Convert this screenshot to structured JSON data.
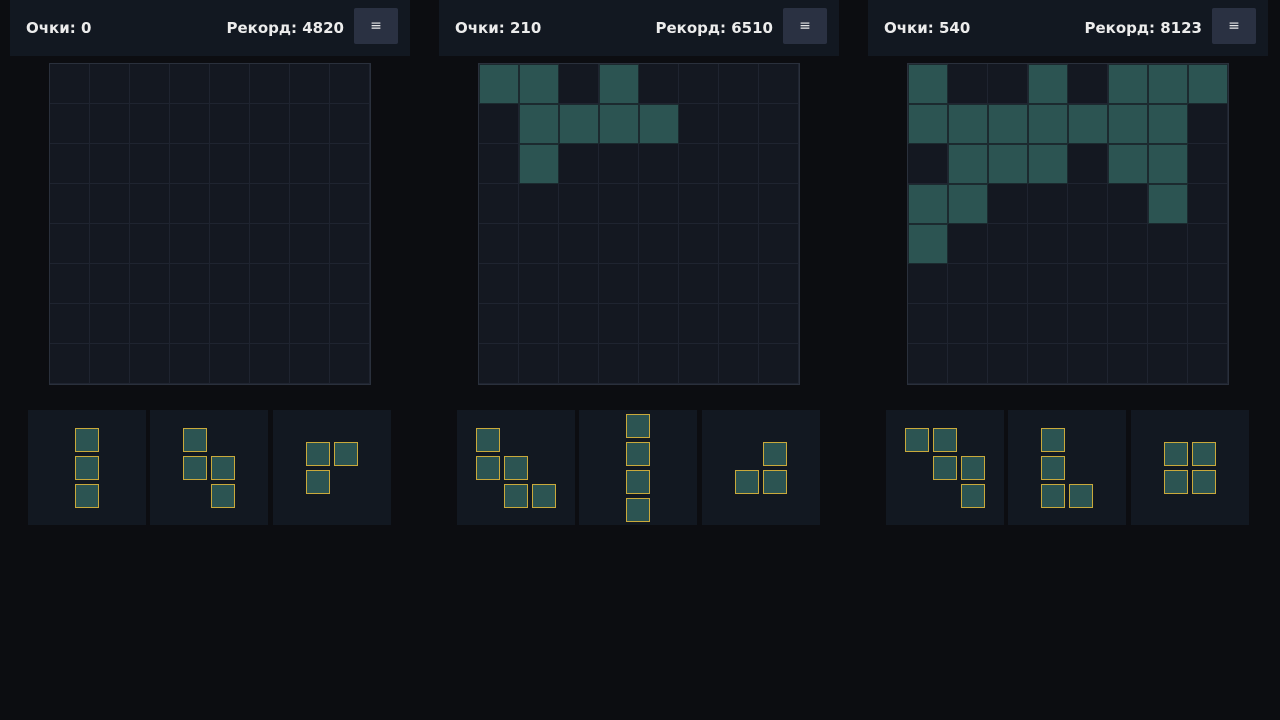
{
  "menu_icon": "≡",
  "colors": {
    "background": "#0c0d11",
    "header": "#121821",
    "board": "#141821",
    "filled_cell": "#2c5452",
    "piece_border": "#c9a93b"
  },
  "games": [
    {
      "score_label": "Очки: 0",
      "record_label": "Рекорд: 4820",
      "board": [
        "........",
        "........",
        "........",
        "........",
        "........",
        "........",
        "........",
        "........"
      ],
      "pieces": [
        [
          "X",
          "X",
          "X"
        ],
        [
          "X.",
          "XX",
          ".X"
        ],
        [
          "XX",
          "X."
        ]
      ]
    },
    {
      "score_label": "Очки: 210",
      "record_label": "Рекорд: 6510",
      "board": [
        "XX.X....",
        ".XXXX...",
        ".X......",
        "........",
        "........",
        "........",
        "........",
        "........"
      ],
      "pieces": [
        [
          "X..",
          "XX.",
          ".XX"
        ],
        [
          "X",
          "X",
          "X",
          "X"
        ],
        [
          ".X",
          "XX"
        ]
      ]
    },
    {
      "score_label": "Очки: 540",
      "record_label": "Рекорд: 8123",
      "board": [
        "X..X.XXX",
        "XXXXXXX.",
        ".XXX.XX.",
        "XX....X.",
        "X.......",
        "........",
        "........",
        "........"
      ],
      "pieces": [
        [
          "XX.",
          ".XX",
          "..X"
        ],
        [
          "X.",
          "X.",
          "XX"
        ],
        [
          "XX",
          "XX"
        ]
      ]
    }
  ]
}
